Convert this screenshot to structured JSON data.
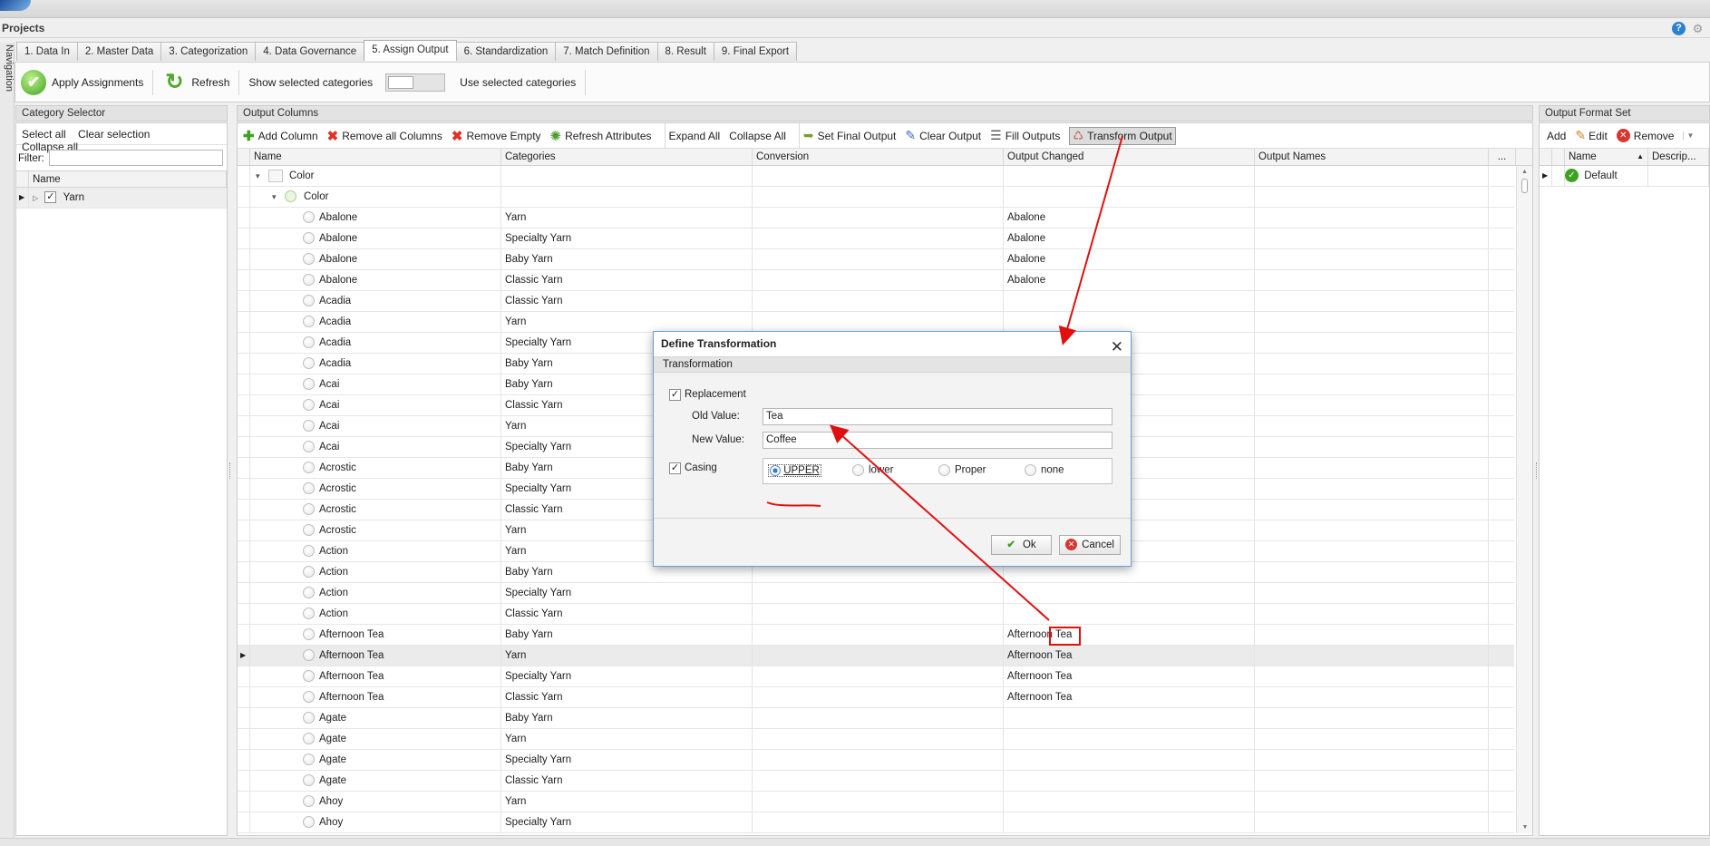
{
  "app": {
    "section_title": "Projects",
    "nav_label": "Navigation"
  },
  "tabs": [
    {
      "label": "1. Data In"
    },
    {
      "label": "2. Master Data"
    },
    {
      "label": "3. Categorization"
    },
    {
      "label": "4. Data Governance"
    },
    {
      "label": "5. Assign Output",
      "active": true
    },
    {
      "label": "6. Standardization"
    },
    {
      "label": "7. Match Definition"
    },
    {
      "label": "8. Result"
    },
    {
      "label": "9. Final Export"
    }
  ],
  "toolbar": {
    "apply_label": "Apply Assignments",
    "refresh_label": "Refresh",
    "show_selected_label": "Show selected categories",
    "use_selected_label": "Use selected categories"
  },
  "category_selector": {
    "title": "Category Selector",
    "select_all": "Select all",
    "clear_selection": "Clear selection",
    "collapse_all": "Collapse all",
    "filter_label": "Filter:",
    "filter_value": "",
    "col_name": "Name",
    "items": [
      {
        "label": "Yarn",
        "checked": true
      }
    ]
  },
  "output_columns": {
    "title": "Output Columns",
    "toolbar": {
      "add_column": "Add Column",
      "remove_all": "Remove all Columns",
      "remove_empty": "Remove Empty",
      "refresh_attributes": "Refresh Attributes",
      "expand_all": "Expand All",
      "collapse_all": "Collapse All",
      "set_final": "Set Final Output",
      "clear_output": "Clear Output",
      "fill_outputs": "Fill Outputs",
      "transform_output": "Transform Output"
    },
    "headers": {
      "name": "Name",
      "categories": "Categories",
      "conversion": "Conversion",
      "output_changed": "Output Changed",
      "output_names": "Output Names",
      "more": "..."
    },
    "group_level1": "Color",
    "group_level2": "Color",
    "rows": [
      {
        "name": "Abalone",
        "category": "Yarn",
        "conversion": "",
        "output": "Abalone"
      },
      {
        "name": "Abalone",
        "category": "Specialty Yarn",
        "conversion": "",
        "output": "Abalone"
      },
      {
        "name": "Abalone",
        "category": "Baby Yarn",
        "conversion": "",
        "output": "Abalone"
      },
      {
        "name": "Abalone",
        "category": "Classic Yarn",
        "conversion": "",
        "output": "Abalone"
      },
      {
        "name": "Acadia",
        "category": "Classic Yarn",
        "conversion": "",
        "output": ""
      },
      {
        "name": "Acadia",
        "category": "Yarn",
        "conversion": "",
        "output": ""
      },
      {
        "name": "Acadia",
        "category": "Specialty Yarn",
        "conversion": "",
        "output": ""
      },
      {
        "name": "Acadia",
        "category": "Baby Yarn",
        "conversion": "",
        "output": ""
      },
      {
        "name": "Acai",
        "category": "Baby Yarn",
        "conversion": "",
        "output": ""
      },
      {
        "name": "Acai",
        "category": "Classic Yarn",
        "conversion": "",
        "output": ""
      },
      {
        "name": "Acai",
        "category": "Yarn",
        "conversion": "",
        "output": ""
      },
      {
        "name": "Acai",
        "category": "Specialty Yarn",
        "conversion": "",
        "output": ""
      },
      {
        "name": "Acrostic",
        "category": "Baby Yarn",
        "conversion": "",
        "output": ""
      },
      {
        "name": "Acrostic",
        "category": "Specialty Yarn",
        "conversion": "",
        "output": ""
      },
      {
        "name": "Acrostic",
        "category": "Classic Yarn",
        "conversion": "",
        "output": ""
      },
      {
        "name": "Acrostic",
        "category": "Yarn",
        "conversion": "",
        "output": ""
      },
      {
        "name": "Action",
        "category": "Yarn",
        "conversion": "",
        "output": ""
      },
      {
        "name": "Action",
        "category": "Baby Yarn",
        "conversion": "",
        "output": ""
      },
      {
        "name": "Action",
        "category": "Specialty Yarn",
        "conversion": "",
        "output": ""
      },
      {
        "name": "Action",
        "category": "Classic Yarn",
        "conversion": "",
        "output": ""
      },
      {
        "name": "Afternoon Tea",
        "category": "Baby Yarn",
        "conversion": "",
        "output": "Afternoon Tea"
      },
      {
        "name": "Afternoon Tea",
        "category": "Yarn",
        "conversion": "",
        "output": "Afternoon Tea",
        "selected": true
      },
      {
        "name": "Afternoon Tea",
        "category": "Specialty Yarn",
        "conversion": "",
        "output": "Afternoon Tea"
      },
      {
        "name": "Afternoon Tea",
        "category": "Classic Yarn",
        "conversion": "",
        "output": "Afternoon Tea"
      },
      {
        "name": "Agate",
        "category": "Baby Yarn",
        "conversion": "",
        "output": ""
      },
      {
        "name": "Agate",
        "category": "Yarn",
        "conversion": "",
        "output": ""
      },
      {
        "name": "Agate",
        "category": "Specialty Yarn",
        "conversion": "",
        "output": ""
      },
      {
        "name": "Agate",
        "category": "Classic Yarn",
        "conversion": "",
        "output": ""
      },
      {
        "name": "Ahoy",
        "category": "Yarn",
        "conversion": "",
        "output": ""
      },
      {
        "name": "Ahoy",
        "category": "Specialty Yarn",
        "conversion": "",
        "output": ""
      }
    ]
  },
  "output_format_set": {
    "title": "Output Format Set",
    "add": "Add",
    "edit": "Edit",
    "remove": "Remove",
    "col_name": "Name",
    "col_desc": "Descrip...",
    "items": [
      {
        "name": "Default"
      }
    ]
  },
  "dialog": {
    "title": "Define Transformation",
    "group_label": "Transformation",
    "replacement_label": "Replacement",
    "replacement_checked": true,
    "old_value_label": "Old Value:",
    "old_value": "Tea",
    "new_value_label": "New Value:",
    "new_value": "Coffee",
    "casing_label": "Casing",
    "casing_checked": true,
    "casing_options": [
      "UPPER",
      "lower",
      "Proper",
      "none"
    ],
    "casing_selected": "UPPER",
    "ok_label": "Ok",
    "cancel_label": "Cancel"
  },
  "colors": {
    "annotation": "#e01010",
    "accent_green": "#3da222",
    "accent_blue": "#2d7fd3"
  }
}
